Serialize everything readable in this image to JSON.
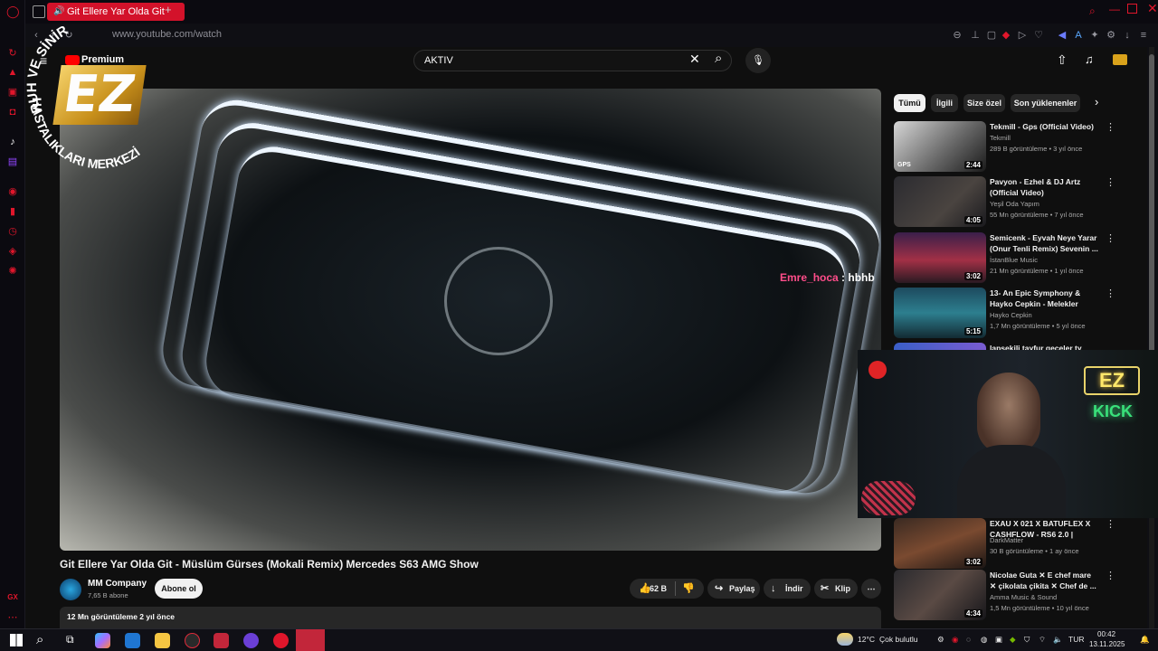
{
  "browser": {
    "tab_title": "Git Ellere Yar Olda Git",
    "new_tab": "+",
    "url": "www.youtube.com/watch"
  },
  "youtube": {
    "logo_text": "Premium",
    "search_value": "AKTIV",
    "video": {
      "title": "Git Ellere Yar Olda Git - Müslüm Gürses (Mokali Remix) Mercedes S63 AMG Show",
      "channel": "MM Company",
      "subscribers": "7,65 B abone",
      "subscribe_label": "Abone ol",
      "likes": "62 B",
      "share_label": "Paylaş",
      "download_label": "İndir",
      "clip_label": "Klip",
      "meta": "12 Mn görüntüleme  2 yıl önce",
      "chat_user": "Emre_hoca",
      "chat_msg": ": hbhb"
    },
    "chips": [
      "Tümü",
      "İlgili",
      "Size özel",
      "Son yüklenenler"
    ],
    "recommendations": [
      {
        "title": "Tekmill - Gps (Official Video)",
        "channel": "Tekmill",
        "meta": "289 B görüntüleme • 3 yıl önce",
        "duration": "2:44",
        "thumb_label": "GPS"
      },
      {
        "title": "Pavyon - Ezhel & DJ Artz (Official Video)",
        "channel": "Yeşil Oda Yapım",
        "meta": "55 Mn görüntüleme • 7 yıl önce",
        "duration": "4:05"
      },
      {
        "title": "Semicenk - Eyvah Neye Yarar (Onur Tenli Remix) Sevenin ...",
        "channel": "İstanBlue Music",
        "meta": "21 Mn görüntüleme • 1 yıl önce",
        "duration": "3:02"
      },
      {
        "title": "13- An Epic Symphony & Hayko Cepkin - Melekler",
        "channel": "Hayko Cepkin",
        "meta": "1,7 Mn görüntüleme • 5 yıl önce",
        "duration": "5:15"
      },
      {
        "title": "lapsekili tayfur geceler ty 2000",
        "channel": "",
        "meta": "",
        "duration": ""
      },
      {
        "title": "EXAU X 021 X BATUFLEX X CASHFLOW - RS6 2.0 | HOND...",
        "channel": "DarkMatter",
        "meta": "30 B görüntüleme • 1 ay önce",
        "duration": "3:02"
      },
      {
        "title": "Nicolae Guta ✕ E chef mare ✕ çikolata çikita ✕ Chef de ...",
        "channel": "Amma Music & Sound",
        "meta": "1,5 Mn görüntüleme • 10 yıl önce",
        "duration": "4:34"
      }
    ]
  },
  "overlay": {
    "ring_top": "RUH VE SİNİR",
    "ring_bottom": "HASTALIKLARI MERKEZİ",
    "logo_letters": "EZ",
    "neon_text": "KICK"
  },
  "taskbar": {
    "weather_temp": "12°C",
    "weather_text": "Çok bulutlu",
    "lang": "TUR",
    "time": "00:42",
    "date": "13.11.2025"
  },
  "colors": {
    "accent": "#d3122a",
    "yt_bg": "#0f0f0f",
    "chip_active": "#f1f1f1",
    "neon": "#39e07a"
  }
}
